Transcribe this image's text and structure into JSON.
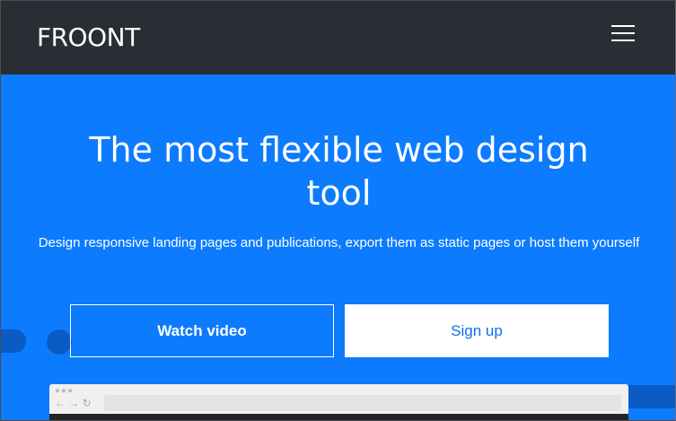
{
  "header": {
    "logo_text": "FROONT",
    "menu_icon": "hamburger-menu-icon"
  },
  "hero": {
    "headline": "The most flexible web design tool",
    "subline": "Design responsive landing pages and publications, export them as static pages or host them yourself",
    "watch_video_label": "Watch video",
    "signup_label": "Sign up"
  },
  "browser_preview": {
    "traffic_lights": "●●●",
    "nav_icons": "← → ↻"
  },
  "colors": {
    "header_bg": "#2a2d33",
    "hero_bg": "#0d7bfd",
    "accent_dark": "#0a5bc4",
    "button_text_blue": "#0d6fe8"
  }
}
